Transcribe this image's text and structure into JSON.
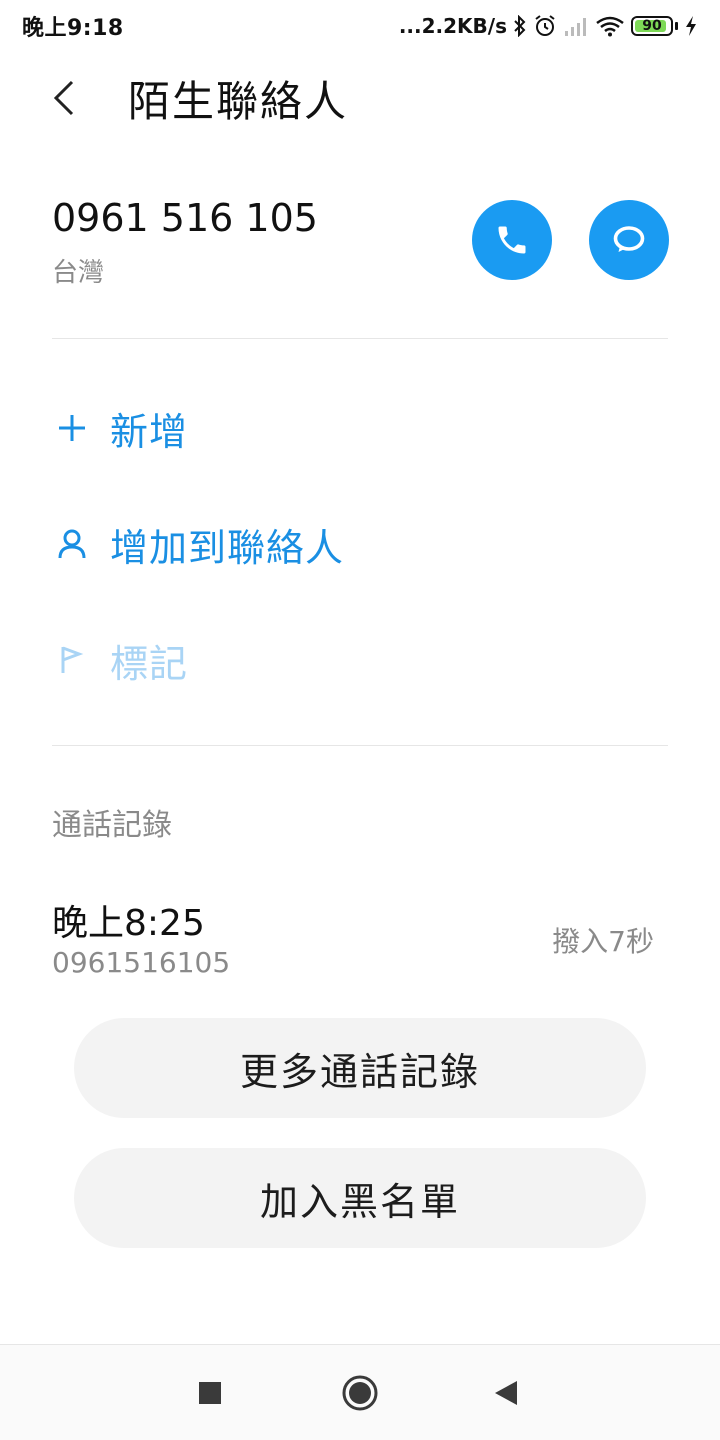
{
  "status_bar": {
    "time": "晚上9:18",
    "net_speed": "...2.2KB/s",
    "battery": "90",
    "battery_level_percent": 90,
    "icons": [
      "bluetooth-icon",
      "alarm-icon",
      "signal-icon",
      "wifi-icon",
      "battery-icon",
      "charging-icon"
    ]
  },
  "header": {
    "title": "陌生聯絡人",
    "back_icon": "chevron-left-icon"
  },
  "contact": {
    "number": "0961 516 105",
    "region": "台灣",
    "call_icon": "phone-icon",
    "message_icon": "message-icon",
    "accent_color": "#1a9bf2"
  },
  "actions": [
    {
      "label": "新增",
      "icon": "plus-icon",
      "enabled": true
    },
    {
      "label": "增加到聯絡人",
      "icon": "person-icon",
      "enabled": true
    },
    {
      "label": "標記",
      "icon": "flag-icon",
      "enabled": false
    }
  ],
  "call_log": {
    "title": "通話記錄",
    "entries": [
      {
        "time": "晚上8:25",
        "number": "0961516105",
        "type": "撥入7秒"
      }
    ]
  },
  "buttons": {
    "more_log": "更多通話記錄",
    "blacklist": "加入黑名單"
  },
  "nav_bar": {
    "icons": [
      "recent-apps-icon",
      "home-icon",
      "back-icon"
    ]
  }
}
